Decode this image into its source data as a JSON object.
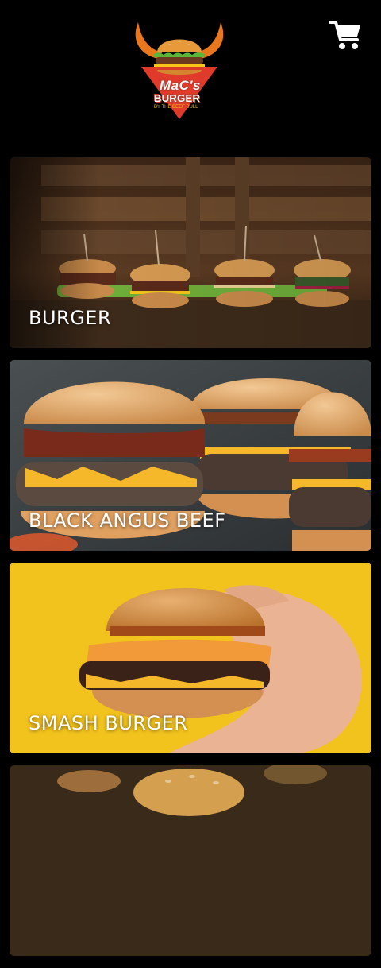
{
  "brand": {
    "logo_line1": "MaC's",
    "logo_line2": "BURGER",
    "logo_line3": "BY THE BEEF BULL"
  },
  "header": {
    "cart_icon": "shopping-cart-icon"
  },
  "categories": [
    {
      "label": "BURGER"
    },
    {
      "label": "BLACK ANGUS BEEF"
    },
    {
      "label": "SMASH BURGER"
    },
    {
      "label": ""
    }
  ],
  "colors": {
    "background": "#000000",
    "accent_red": "#e74c3c",
    "accent_orange": "#e67e22",
    "smash_bg": "#f2c21d"
  }
}
